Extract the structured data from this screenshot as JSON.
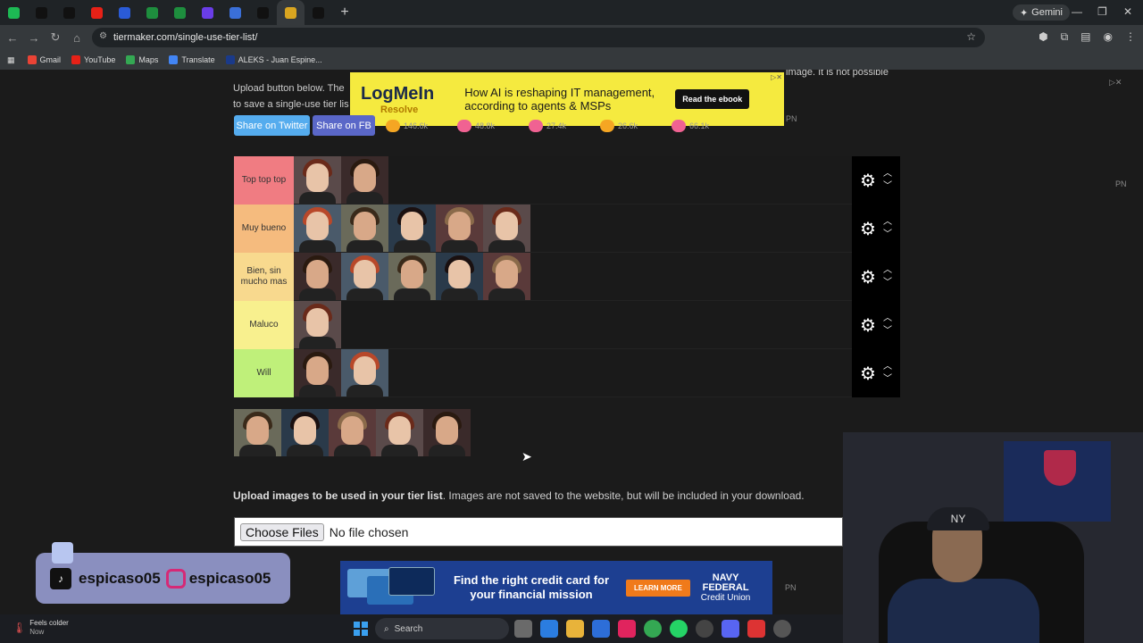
{
  "browser": {
    "url": "tiermaker.com/single-use-tier-list/",
    "gemini_label": "Gemini",
    "tab_colors": [
      "#1db954",
      "#111",
      "#111",
      "#e62117",
      "#2a5bd7",
      "#1e8e3e",
      "#1e8e3e",
      "#6a3de8",
      "#3a6fd8",
      "#111",
      "#d9a520",
      "#111"
    ],
    "bookmarks": [
      {
        "label": "Gmail",
        "color": "#ea4335"
      },
      {
        "label": "YouTube",
        "color": "#e62117"
      },
      {
        "label": "Maps",
        "color": "#34a853"
      },
      {
        "label": "Translate",
        "color": "#4285f4"
      },
      {
        "label": "ALEKS - Juan Espine...",
        "color": "#1a3a8a"
      }
    ]
  },
  "page": {
    "intro_line1": "Upload button below. The",
    "intro_line2": "to save a single-use tier lis",
    "intro_right": "image. It is not possible",
    "share_twitter": "Share on Twitter",
    "share_fb": "Share on FB",
    "reactions": [
      {
        "count": "146.6k",
        "color": "#f5a623"
      },
      {
        "count": "48.8k",
        "color": "#f06292"
      },
      {
        "count": "27.4k",
        "color": "#f06292"
      },
      {
        "count": "26.6k",
        "color": "#f5a623"
      },
      {
        "count": "66.1k",
        "color": "#f06292"
      }
    ],
    "ad_top": {
      "brand": "LogMeIn",
      "product": "Resolve",
      "text": "How AI is reshaping IT management, according to agents & MSPs",
      "button": "Read the ebook"
    },
    "pn": "PN",
    "tiers": [
      {
        "label": "Top top top",
        "color": "#f07c82",
        "count": 2
      },
      {
        "label": "Muy bueno",
        "color": "#f5bb7e",
        "count": 5
      },
      {
        "label": "Bien, sin mucho mas",
        "color": "#f8d98e",
        "count": 5
      },
      {
        "label": "Maluco",
        "color": "#f8f08e",
        "count": 1
      },
      {
        "label": "Will",
        "color": "#bff07a",
        "count": 2
      }
    ],
    "upload_bold": "Upload images to be used in your tier list",
    "upload_rest": ". Images are not saved to the website, but will be included in your download.",
    "file_button": "Choose Files",
    "file_status": "No file chosen"
  },
  "overlay": {
    "tiktok_handle": "espicaso05",
    "instagram_handle": "espicaso05",
    "ad_bottom": {
      "text": "Find the right credit card for your financial mission",
      "button": "LEARN MORE",
      "brand1": "NAVY",
      "brand2": "FEDERAL",
      "brand3": "Credit Union"
    }
  },
  "taskbar": {
    "weather_title": "Feels colder",
    "weather_sub": "Now",
    "search": "Search"
  }
}
